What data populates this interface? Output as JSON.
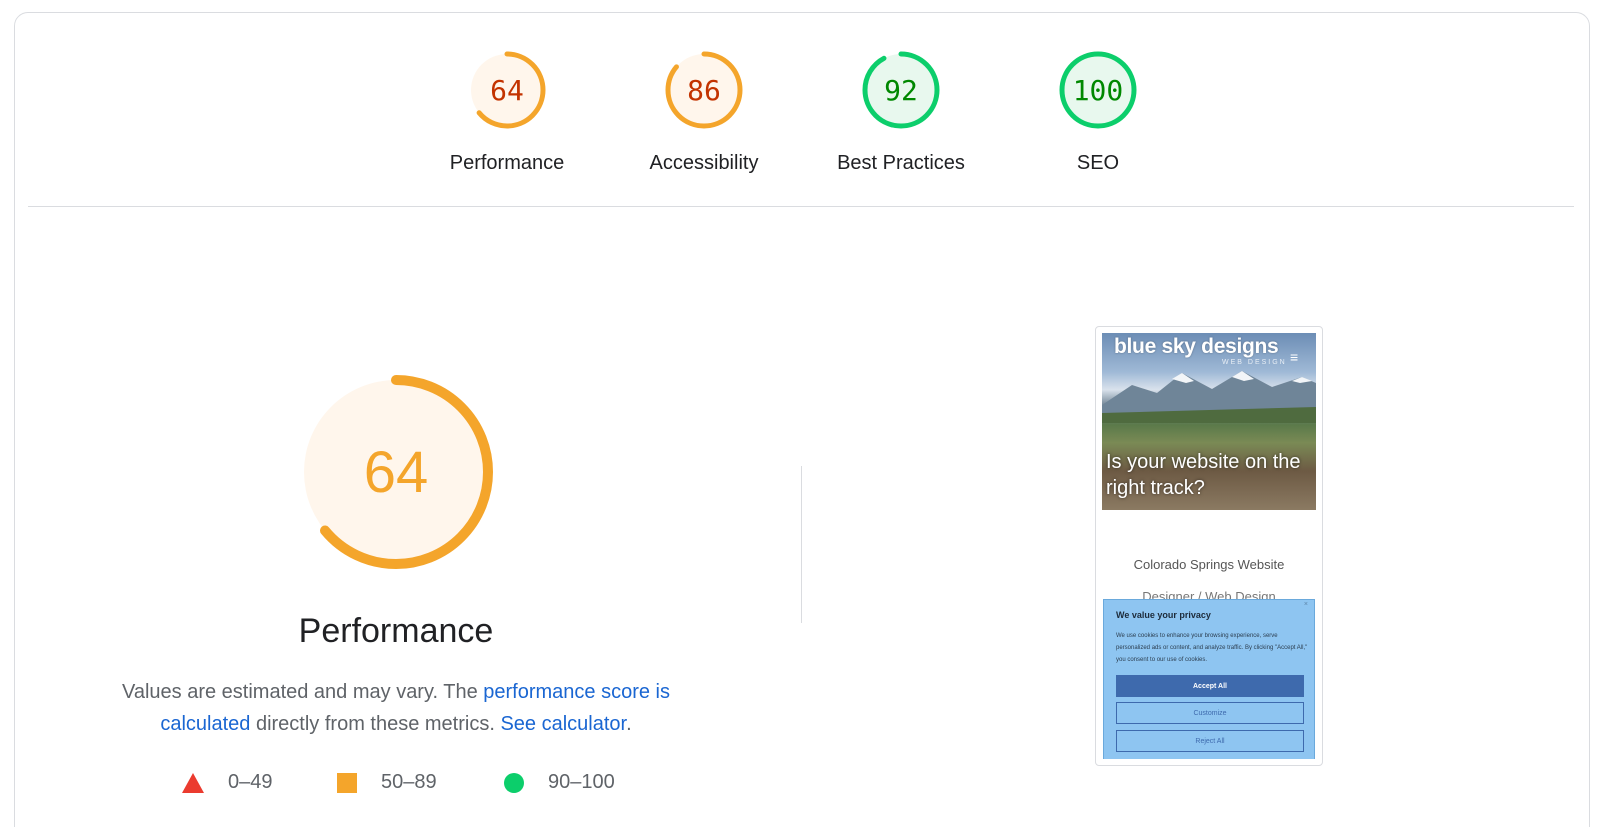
{
  "categories": [
    {
      "label": "Performance",
      "score": 64,
      "rating": "average",
      "color": "#f4a52b",
      "text_color": "#c33300",
      "fill": "#fff6ec"
    },
    {
      "label": "Accessibility",
      "score": 86,
      "rating": "average",
      "color": "#f4a52b",
      "text_color": "#c33300",
      "fill": "#fff6ec"
    },
    {
      "label": "Best Practices",
      "score": 92,
      "rating": "pass",
      "color": "#0cce6b",
      "text_color": "#008800",
      "fill": "#e8f8ee"
    },
    {
      "label": "SEO",
      "score": 100,
      "rating": "pass",
      "color": "#0cce6b",
      "text_color": "#008800",
      "fill": "#e8f8ee"
    }
  ],
  "performance": {
    "score": "64",
    "title": "Performance",
    "desc_part1": "Values are estimated and may vary. The ",
    "link_score": "performance score is calculated",
    "desc_part2": " directly from these metrics. ",
    "link_calc": "See calculator",
    "desc_part3": ".",
    "color": "#f4a52b",
    "fill": "#fff6ec"
  },
  "legend": [
    {
      "shape": "triangle",
      "label": "0–49",
      "color": "#eb3b2f"
    },
    {
      "shape": "square",
      "label": "50–89",
      "color": "#f4a52b"
    },
    {
      "shape": "circle",
      "label": "90–100",
      "color": "#0cce6b"
    }
  ],
  "screenshot": {
    "logo": "blue sky designs",
    "logo_sub": "WEB DESIGN",
    "menu_icon": "hamburger-icon",
    "headline": "Is your website on the right track?",
    "line1": "Colorado Springs Website",
    "line2": "Designer / Web Design",
    "cookie": {
      "title": "We value your privacy",
      "close": "×",
      "text": "We use cookies to enhance your browsing experience, serve personalized ads or content, and analyze traffic. By clicking \"Accept All,\" you consent to our use of cookies.",
      "accept": "Accept All",
      "customize": "Customize",
      "reject": "Reject All"
    }
  }
}
